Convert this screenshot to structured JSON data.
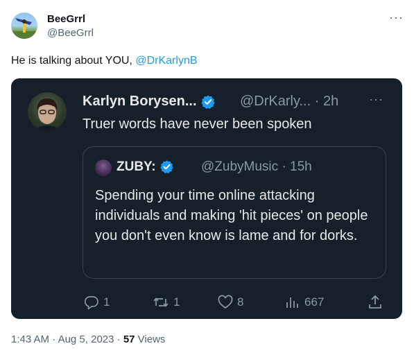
{
  "tweet": {
    "author_name": "BeeGrrl",
    "author_handle": "@BeeGrrl",
    "text_prefix": "He is talking about YOU, ",
    "mention": "@DrKarlynB",
    "time": "1:43 AM",
    "separator": "·",
    "date": "Aug 5, 2023",
    "views_count": "57",
    "views_label": "Views"
  },
  "screenshot": {
    "author_name": "Karlyn Borysen...",
    "handle": "@DrKarly...",
    "time": "· 2h",
    "text": "Truer words have never been spoken",
    "quote": {
      "author_name": "ZUBY:",
      "handle": "@ZubyMusic",
      "time": "· 15h",
      "text": "Spending your time online attacking individuals and making 'hit pieces' on people you don't even know is lame and for dorks."
    },
    "actions": {
      "replies": "1",
      "retweets": "1",
      "likes": "8",
      "views": "667"
    }
  },
  "icons": {
    "more": "more-horizontal-icon",
    "verified": "verified-badge-icon",
    "reply": "reply-icon",
    "retweet": "retweet-icon",
    "like": "heart-icon",
    "views": "analytics-icon",
    "share": "share-icon"
  },
  "colors": {
    "link": "#1d9bf0",
    "card_bg": "#15202b",
    "muted": "#536471",
    "dark_muted": "#8b98a5"
  }
}
